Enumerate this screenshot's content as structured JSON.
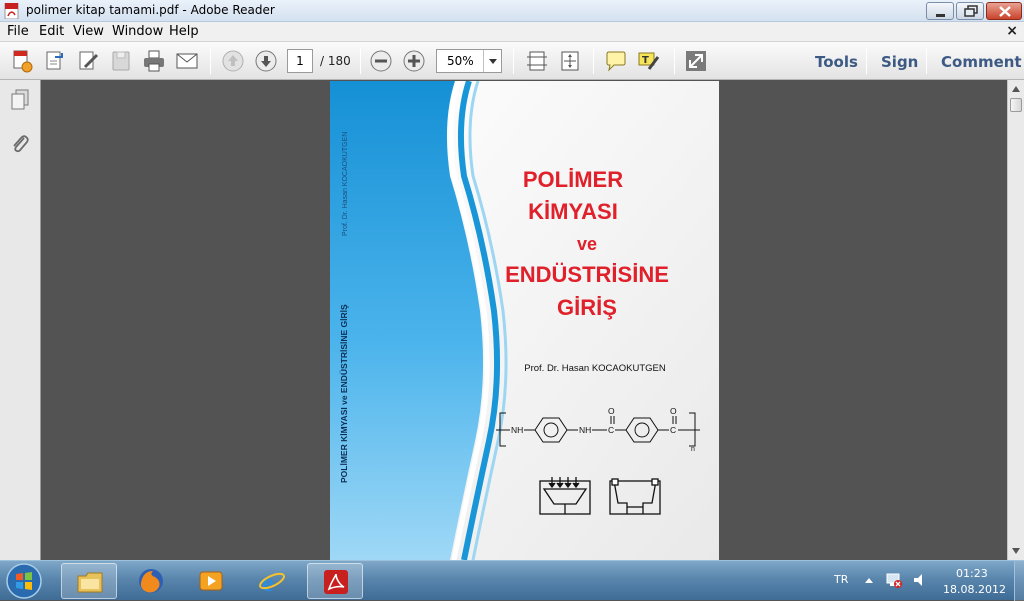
{
  "window": {
    "title": "polimer kitap tamami.pdf - Adobe Reader"
  },
  "menu": {
    "items": [
      "File",
      "Edit",
      "View",
      "Window",
      "Help"
    ],
    "close_glyph": "×"
  },
  "toolbar": {
    "page_current": "1",
    "page_total": "/ 180",
    "zoom": "50%",
    "links": [
      "Tools",
      "Sign",
      "Comment"
    ]
  },
  "cover": {
    "spine_author": "Prof. Dr. Hasan KOCAOKUTGEN",
    "spine_title": "POLİMER KİMYASI ve ENDÜSTRİSİNE GİRİŞ",
    "title_lines": [
      "POLİMER",
      "KİMYASI",
      "ve",
      "ENDÜSTRİSİNE",
      "GİRİŞ"
    ],
    "author": "Prof. Dr. Hasan KOCAOKUTGEN",
    "formula": {
      "nh1": "NH",
      "nh2": "NH",
      "c1": "C",
      "c2": "C",
      "o1": "O",
      "o2": "O",
      "n": "n"
    },
    "colors": {
      "title_red": "#e0202a",
      "band_blue": "#1a93d6",
      "band_light": "#9fd8f6"
    }
  },
  "taskbar": {
    "lang": "TR",
    "time": "01:23",
    "date": "18.08.2012",
    "apps": [
      "windows-explorer",
      "firefox",
      "media-player",
      "internet-explorer",
      "adobe-reader"
    ]
  }
}
